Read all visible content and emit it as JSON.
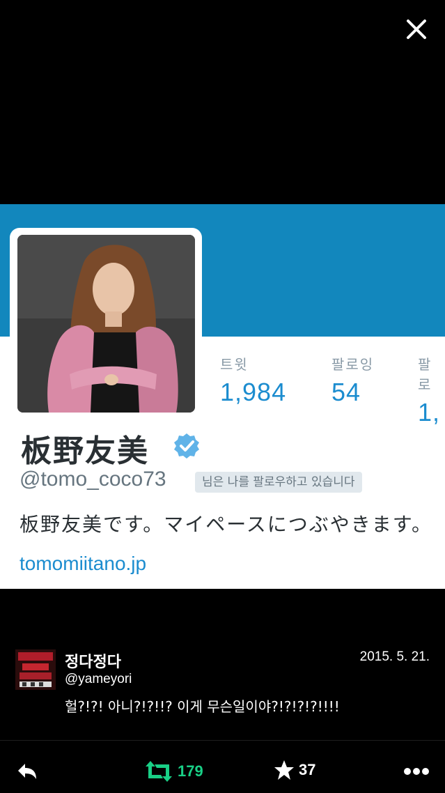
{
  "colors": {
    "background": "#000000",
    "banner": "#1287bd",
    "link": "#1b8ccf",
    "retweet": "#19cf86"
  },
  "close_icon": "close-icon",
  "embedded_profile": {
    "stats": [
      {
        "label": "트윗",
        "value": "1,984"
      },
      {
        "label": "팔로잉",
        "value": "54"
      },
      {
        "label": "팔로",
        "value": "1,"
      }
    ],
    "name": "板野友美",
    "verified_icon": "verified-badge-icon",
    "handle": "@tomo_coco73",
    "follows_badge": "님은 나를 팔로우하고 있습니다",
    "bio": "板野友美です。マイペースにつぶやきます。",
    "url": "tomomiitano.jp"
  },
  "tweet": {
    "author_name": "정다정다",
    "author_handle": "@yameyori",
    "timestamp": "2015. 5. 21.",
    "text": "헐?!?! 아니?!?!!? 이게 무슨일이야?!?!?!?!!!!"
  },
  "actions": {
    "reply_icon": "reply-icon",
    "retweet_icon": "retweet-icon",
    "retweet_count": "179",
    "favorite_icon": "star-icon",
    "favorite_count": "37",
    "more_icon": "more-icon"
  }
}
